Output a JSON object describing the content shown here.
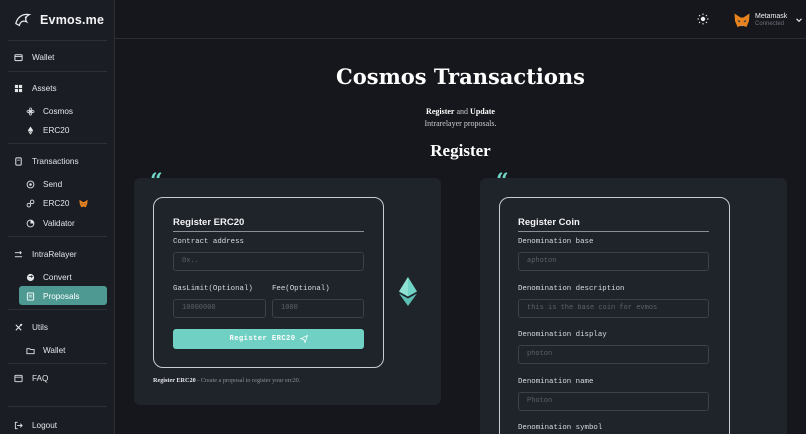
{
  "app": {
    "logo_text": "Evmos.me"
  },
  "sidebar": {
    "items": [
      {
        "label": "Wallet",
        "icon": "wallet-icon"
      },
      {
        "label": "Assets",
        "icon": "grid-icon"
      },
      {
        "label": "Cosmos",
        "icon": "cosmos-atom-icon"
      },
      {
        "label": "ERC20",
        "icon": "ethereum-icon"
      },
      {
        "label": "Transactions",
        "icon": "document-icon"
      },
      {
        "label": "Send",
        "icon": "send-circle-icon"
      },
      {
        "label": "ERC20",
        "icon": "chain-link-icon"
      },
      {
        "label": "Validator",
        "icon": "validator-icon"
      },
      {
        "label": "IntraRelayer",
        "icon": "relay-icon"
      },
      {
        "label": "Convert",
        "icon": "convert-icon"
      },
      {
        "label": "Proposals",
        "icon": "proposal-icon"
      },
      {
        "label": "Utils",
        "icon": "tools-icon"
      },
      {
        "label": "Wallet",
        "icon": "folder-icon"
      },
      {
        "label": "FAQ",
        "icon": "faq-icon"
      },
      {
        "label": "Logout",
        "icon": "logout-icon"
      }
    ],
    "active_item": "Proposals",
    "accent_color": "#4e9a93"
  },
  "topbar": {
    "theme_icon": "sun-icon",
    "wallet_name": "Metamask",
    "wallet_status": "Connected"
  },
  "main": {
    "title": "Cosmos Transactions",
    "subtitle_bold_1": "Register",
    "subtitle_and": "and",
    "subtitle_bold_2": "Update",
    "subtitle_line2": "Intrarelayer proposals.",
    "section_title": "Register",
    "quote_mark": "“"
  },
  "register_erc20": {
    "title": "Register ERC20",
    "contract_label": "Contract address",
    "contract_placeholder": "0x..",
    "gas_label": "GasLimit(Optional)",
    "gas_placeholder": "10000000",
    "fee_label": "Fee(Optional)",
    "fee_placeholder": "1000",
    "button_label": "Register ERC20",
    "caption_bold": "Register ERC20",
    "caption_text": " - Create a proposal to register your erc20."
  },
  "register_coin": {
    "title": "Register Coin",
    "fields": [
      {
        "label": "Denomination base",
        "placeholder": "aphoton"
      },
      {
        "label": "Denomination description",
        "placeholder": "this is the base coin for evmos"
      },
      {
        "label": "Denomination display",
        "placeholder": "photon"
      },
      {
        "label": "Denomination name",
        "placeholder": "Photon"
      },
      {
        "label": "Denomination symbol",
        "placeholder": ""
      }
    ]
  },
  "colors": {
    "background": "#15171c",
    "panel": "#1f232a",
    "accent": "#6fd0c3",
    "quote": "#6fd3c5"
  }
}
